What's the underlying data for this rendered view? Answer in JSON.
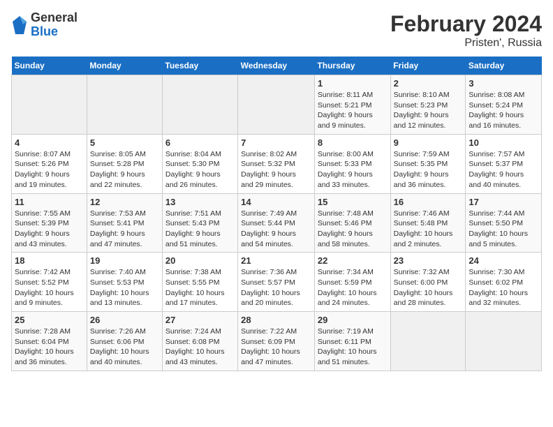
{
  "logo": {
    "general": "General",
    "blue": "Blue"
  },
  "title": "February 2024",
  "subtitle": "Pristen', Russia",
  "weekdays": [
    "Sunday",
    "Monday",
    "Tuesday",
    "Wednesday",
    "Thursday",
    "Friday",
    "Saturday"
  ],
  "weeks": [
    [
      {
        "day": "",
        "info": ""
      },
      {
        "day": "",
        "info": ""
      },
      {
        "day": "",
        "info": ""
      },
      {
        "day": "",
        "info": ""
      },
      {
        "day": "1",
        "info": "Sunrise: 8:11 AM\nSunset: 5:21 PM\nDaylight: 9 hours\nand 9 minutes."
      },
      {
        "day": "2",
        "info": "Sunrise: 8:10 AM\nSunset: 5:23 PM\nDaylight: 9 hours\nand 12 minutes."
      },
      {
        "day": "3",
        "info": "Sunrise: 8:08 AM\nSunset: 5:24 PM\nDaylight: 9 hours\nand 16 minutes."
      }
    ],
    [
      {
        "day": "4",
        "info": "Sunrise: 8:07 AM\nSunset: 5:26 PM\nDaylight: 9 hours\nand 19 minutes."
      },
      {
        "day": "5",
        "info": "Sunrise: 8:05 AM\nSunset: 5:28 PM\nDaylight: 9 hours\nand 22 minutes."
      },
      {
        "day": "6",
        "info": "Sunrise: 8:04 AM\nSunset: 5:30 PM\nDaylight: 9 hours\nand 26 minutes."
      },
      {
        "day": "7",
        "info": "Sunrise: 8:02 AM\nSunset: 5:32 PM\nDaylight: 9 hours\nand 29 minutes."
      },
      {
        "day": "8",
        "info": "Sunrise: 8:00 AM\nSunset: 5:33 PM\nDaylight: 9 hours\nand 33 minutes."
      },
      {
        "day": "9",
        "info": "Sunrise: 7:59 AM\nSunset: 5:35 PM\nDaylight: 9 hours\nand 36 minutes."
      },
      {
        "day": "10",
        "info": "Sunrise: 7:57 AM\nSunset: 5:37 PM\nDaylight: 9 hours\nand 40 minutes."
      }
    ],
    [
      {
        "day": "11",
        "info": "Sunrise: 7:55 AM\nSunset: 5:39 PM\nDaylight: 9 hours\nand 43 minutes."
      },
      {
        "day": "12",
        "info": "Sunrise: 7:53 AM\nSunset: 5:41 PM\nDaylight: 9 hours\nand 47 minutes."
      },
      {
        "day": "13",
        "info": "Sunrise: 7:51 AM\nSunset: 5:43 PM\nDaylight: 9 hours\nand 51 minutes."
      },
      {
        "day": "14",
        "info": "Sunrise: 7:49 AM\nSunset: 5:44 PM\nDaylight: 9 hours\nand 54 minutes."
      },
      {
        "day": "15",
        "info": "Sunrise: 7:48 AM\nSunset: 5:46 PM\nDaylight: 9 hours\nand 58 minutes."
      },
      {
        "day": "16",
        "info": "Sunrise: 7:46 AM\nSunset: 5:48 PM\nDaylight: 10 hours\nand 2 minutes."
      },
      {
        "day": "17",
        "info": "Sunrise: 7:44 AM\nSunset: 5:50 PM\nDaylight: 10 hours\nand 5 minutes."
      }
    ],
    [
      {
        "day": "18",
        "info": "Sunrise: 7:42 AM\nSunset: 5:52 PM\nDaylight: 10 hours\nand 9 minutes."
      },
      {
        "day": "19",
        "info": "Sunrise: 7:40 AM\nSunset: 5:53 PM\nDaylight: 10 hours\nand 13 minutes."
      },
      {
        "day": "20",
        "info": "Sunrise: 7:38 AM\nSunset: 5:55 PM\nDaylight: 10 hours\nand 17 minutes."
      },
      {
        "day": "21",
        "info": "Sunrise: 7:36 AM\nSunset: 5:57 PM\nDaylight: 10 hours\nand 20 minutes."
      },
      {
        "day": "22",
        "info": "Sunrise: 7:34 AM\nSunset: 5:59 PM\nDaylight: 10 hours\nand 24 minutes."
      },
      {
        "day": "23",
        "info": "Sunrise: 7:32 AM\nSunset: 6:00 PM\nDaylight: 10 hours\nand 28 minutes."
      },
      {
        "day": "24",
        "info": "Sunrise: 7:30 AM\nSunset: 6:02 PM\nDaylight: 10 hours\nand 32 minutes."
      }
    ],
    [
      {
        "day": "25",
        "info": "Sunrise: 7:28 AM\nSunset: 6:04 PM\nDaylight: 10 hours\nand 36 minutes."
      },
      {
        "day": "26",
        "info": "Sunrise: 7:26 AM\nSunset: 6:06 PM\nDaylight: 10 hours\nand 40 minutes."
      },
      {
        "day": "27",
        "info": "Sunrise: 7:24 AM\nSunset: 6:08 PM\nDaylight: 10 hours\nand 43 minutes."
      },
      {
        "day": "28",
        "info": "Sunrise: 7:22 AM\nSunset: 6:09 PM\nDaylight: 10 hours\nand 47 minutes."
      },
      {
        "day": "29",
        "info": "Sunrise: 7:19 AM\nSunset: 6:11 PM\nDaylight: 10 hours\nand 51 minutes."
      },
      {
        "day": "",
        "info": ""
      },
      {
        "day": "",
        "info": ""
      }
    ]
  ]
}
